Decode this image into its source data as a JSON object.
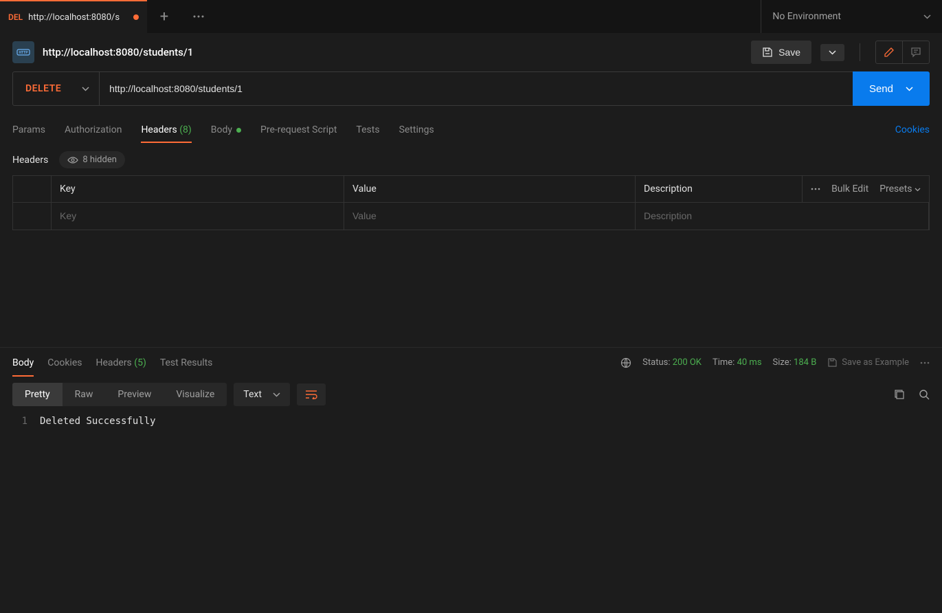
{
  "tab": {
    "method": "DEL",
    "title": "http://localhost:8080/s"
  },
  "env": {
    "label": "No Environment"
  },
  "request": {
    "name": "http://localhost:8080/students/1",
    "method": "DELETE",
    "url": "http://localhost:8080/students/1",
    "save_label": "Save",
    "send_label": "Send"
  },
  "req_tabs": {
    "params": "Params",
    "authorization": "Authorization",
    "headers": "Headers",
    "headers_count": "(8)",
    "body": "Body",
    "prerequest": "Pre-request Script",
    "tests": "Tests",
    "settings": "Settings",
    "cookies": "Cookies"
  },
  "headers_section": {
    "title": "Headers",
    "hidden_text": "8 hidden",
    "col_key": "Key",
    "col_value": "Value",
    "col_description": "Description",
    "bulk_edit": "Bulk Edit",
    "presets": "Presets",
    "placeholder_key": "Key",
    "placeholder_value": "Value",
    "placeholder_description": "Description"
  },
  "resp_tabs": {
    "body": "Body",
    "cookies": "Cookies",
    "headers": "Headers",
    "headers_count": "(5)",
    "test_results": "Test Results"
  },
  "resp_meta": {
    "status_label": "Status:",
    "status_value": "200 OK",
    "time_label": "Time:",
    "time_value": "40 ms",
    "size_label": "Size:",
    "size_value": "184 B",
    "save_example": "Save as Example"
  },
  "view_tabs": {
    "pretty": "Pretty",
    "raw": "Raw",
    "preview": "Preview",
    "visualize": "Visualize",
    "format": "Text"
  },
  "response_body": {
    "line1_no": "1",
    "line1_text": "Deleted Successfully"
  }
}
